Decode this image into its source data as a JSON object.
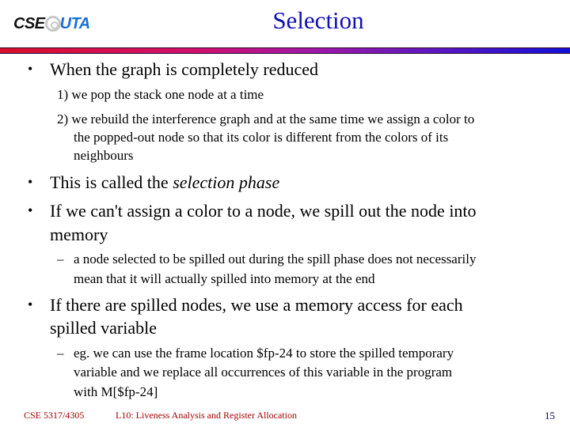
{
  "header": {
    "logo": {
      "left": "CSE",
      "right": "UTA",
      "colors": {
        "cse": "#111111",
        "at": "#c8c8c8",
        "uta": "#1a6fd0"
      }
    },
    "title": "Selection",
    "title_color": "#1010b8",
    "divider_gradient": [
      "#d8102a",
      "#d01070",
      "#a018a8",
      "#6018c0",
      "#1010d8"
    ]
  },
  "body": {
    "bullet1": {
      "text": "When the graph is completely reduced",
      "sub": [
        {
          "num": "1)",
          "lines": [
            "we pop the stack one node at a time"
          ]
        },
        {
          "num": "2)",
          "lines": [
            "we rebuild the interference graph and at the same time we assign a color to",
            "the popped-out node so that its color is different from the colors of its",
            "neighbours"
          ]
        }
      ]
    },
    "bullet2": {
      "prefix": "This is called the ",
      "emphasis": "selection phase"
    },
    "bullet3": {
      "lines": [
        "If we can't assign a color to a node, we spill out the node into",
        "memory"
      ],
      "sub": {
        "lines": [
          "a node selected to be spilled out during the spill phase does not necessarily",
          "mean that it will actually spilled into memory at the end"
        ]
      }
    },
    "bullet4": {
      "lines": [
        "If there are spilled nodes, we use a memory access for each",
        "spilled variable"
      ],
      "sub": {
        "lines": [
          "eg. we can use the frame location $fp-24 to store the spilled temporary",
          "variable and we replace all occurrences of this variable in the program",
          "with M[$fp-24]"
        ]
      }
    },
    "bullet_glyph": "•",
    "dash_glyph": "–"
  },
  "footer": {
    "course": "CSE 5317/4305",
    "lecture": "L10: Liveness Analysis and Register Allocation",
    "page": "15"
  }
}
